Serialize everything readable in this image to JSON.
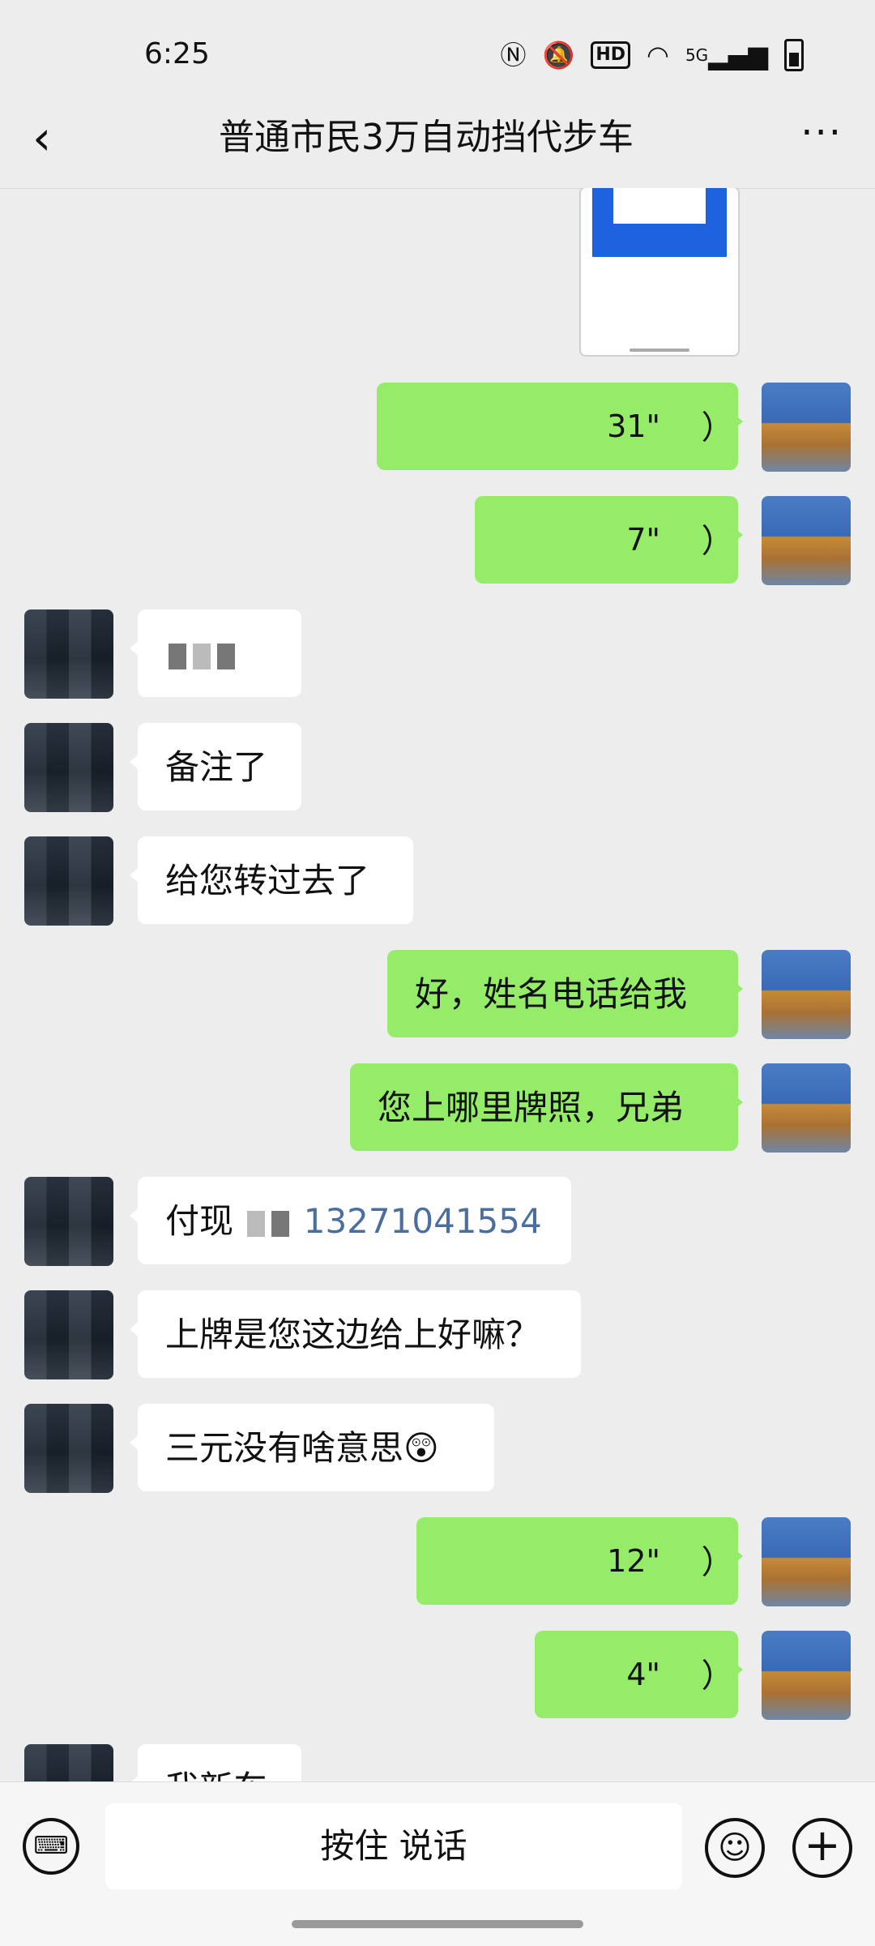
{
  "status": {
    "time": "6:25",
    "icons": [
      "nfc-icon",
      "mute-icon",
      "hd-icon",
      "wifi-icon",
      "5g-signal-icon",
      "battery-icon"
    ],
    "hd_label": "HD",
    "network": "5G"
  },
  "header": {
    "title": "普通市民3万自动挡代步车"
  },
  "messages": {
    "v1": {
      "duration": "31\""
    },
    "v2": {
      "duration": "7\""
    },
    "m3": {
      "text": "备注了"
    },
    "m4": {
      "text": "给您转过去了"
    },
    "m5": {
      "text": "好，姓名电话给我"
    },
    "m6": {
      "text": "您上哪里牌照，兄弟"
    },
    "m7": {
      "prefix": "付现",
      "number": "13271041554"
    },
    "m8": {
      "text": "上牌是您这边给上好嘛？"
    },
    "m9": {
      "text": "三元没有啥意思😲"
    },
    "v3": {
      "duration": "12\""
    },
    "v4": {
      "duration": "4\""
    },
    "m10": {
      "text": "我新车"
    }
  },
  "input_bar": {
    "hold_to_talk": "按住 说话"
  }
}
